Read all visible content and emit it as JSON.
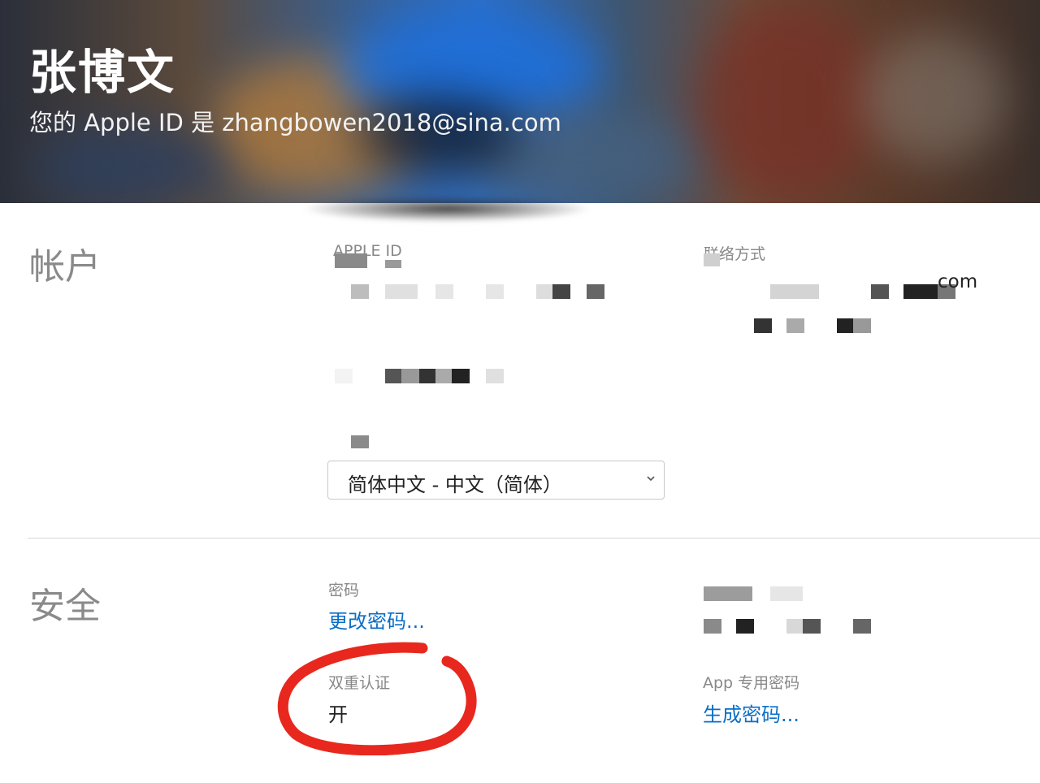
{
  "header": {
    "name": "张博文",
    "apple_id_line": "您的 Apple ID 是 zhangbowen2018@sina.com"
  },
  "account": {
    "section_title": "帐户",
    "apple_id_label": "APPLE ID",
    "contact_label": "联络方式",
    "contact_suffix": "com",
    "language_value": "简体中文 - 中文（简体）"
  },
  "security": {
    "section_title": "安全",
    "password_label": "密码",
    "change_password_link": "更改密码...",
    "two_factor_label": "双重认证",
    "two_factor_value": "开",
    "app_password_label": "App 专用密码",
    "generate_password_link": "生成密码..."
  },
  "colors": {
    "link": "#0a6ec6",
    "annotation_circle": "#e8281e"
  }
}
